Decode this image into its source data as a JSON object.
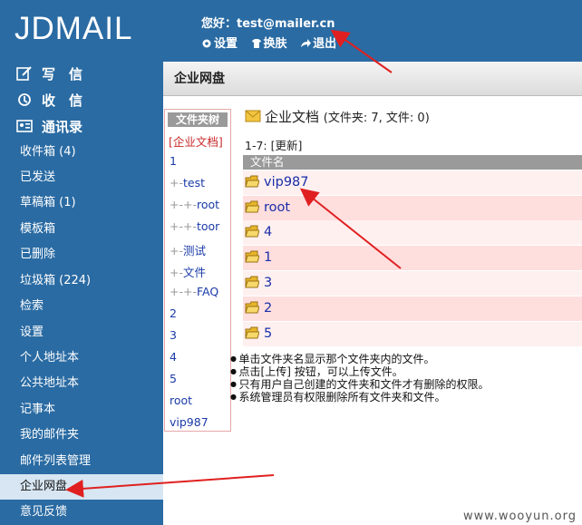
{
  "app": {
    "logo": "JDMAIL"
  },
  "header": {
    "greeting": "您好：test@mailer.cn",
    "settings": "设置",
    "skin": "换肤",
    "logout": "退出"
  },
  "sidebar": {
    "quick": [
      "写　信",
      "收　信",
      "通讯录"
    ],
    "items": [
      "收件箱 (4)",
      "已发送",
      "草稿箱 (1)",
      "模板箱",
      "已删除",
      "垃圾箱 (224)",
      "检索",
      "设置",
      "个人地址本",
      "公共地址本",
      "记事本",
      "我的邮件夹",
      "邮件列表管理",
      "企业网盘",
      "意见反馈"
    ],
    "active_index": 13
  },
  "main": {
    "section_title": "企业网盘",
    "tree": {
      "heading": "文件夹树",
      "root": "[企业文档]",
      "items": [
        {
          "guide": "",
          "label": "1"
        },
        {
          "guide": "+-",
          "label": "test"
        },
        {
          "guide": "+-+-",
          "label": "root"
        },
        {
          "guide": "+-+-",
          "label": "toor"
        },
        {
          "guide": "+-",
          "label": "测试"
        },
        {
          "guide": "+-",
          "label": "文件"
        },
        {
          "guide": "+-+-",
          "label": "FAQ"
        },
        {
          "guide": "",
          "label": "2"
        },
        {
          "guide": "",
          "label": "3"
        },
        {
          "guide": "",
          "label": "4"
        },
        {
          "guide": "",
          "label": "5"
        },
        {
          "guide": "",
          "label": "root"
        },
        {
          "guide": "",
          "label": "vip987"
        }
      ]
    },
    "doc_title": "企业文档",
    "doc_stats": "(文件夹: 7, 文件: 0)",
    "pager_range": "1-7: ",
    "refresh": "[更新]",
    "column_header": "文件名",
    "files": [
      "vip987",
      "root",
      "4",
      "1",
      "3",
      "2",
      "5"
    ],
    "notes": [
      "单击文件夹名显示那个文件夹内的文件。",
      "点击[上传] 按钮，可以上传文件。",
      "只有用户自己创建的文件夹和文件才有删除的权限。",
      "系统管理员有权限删除所有文件夹和文件。"
    ]
  },
  "watermark": "www.wooyun.org",
  "colors": {
    "sidebar": "#2a6ba3",
    "active": "#d7e6f2",
    "annotation": "#e02020",
    "row_alt": "#ffdede"
  }
}
